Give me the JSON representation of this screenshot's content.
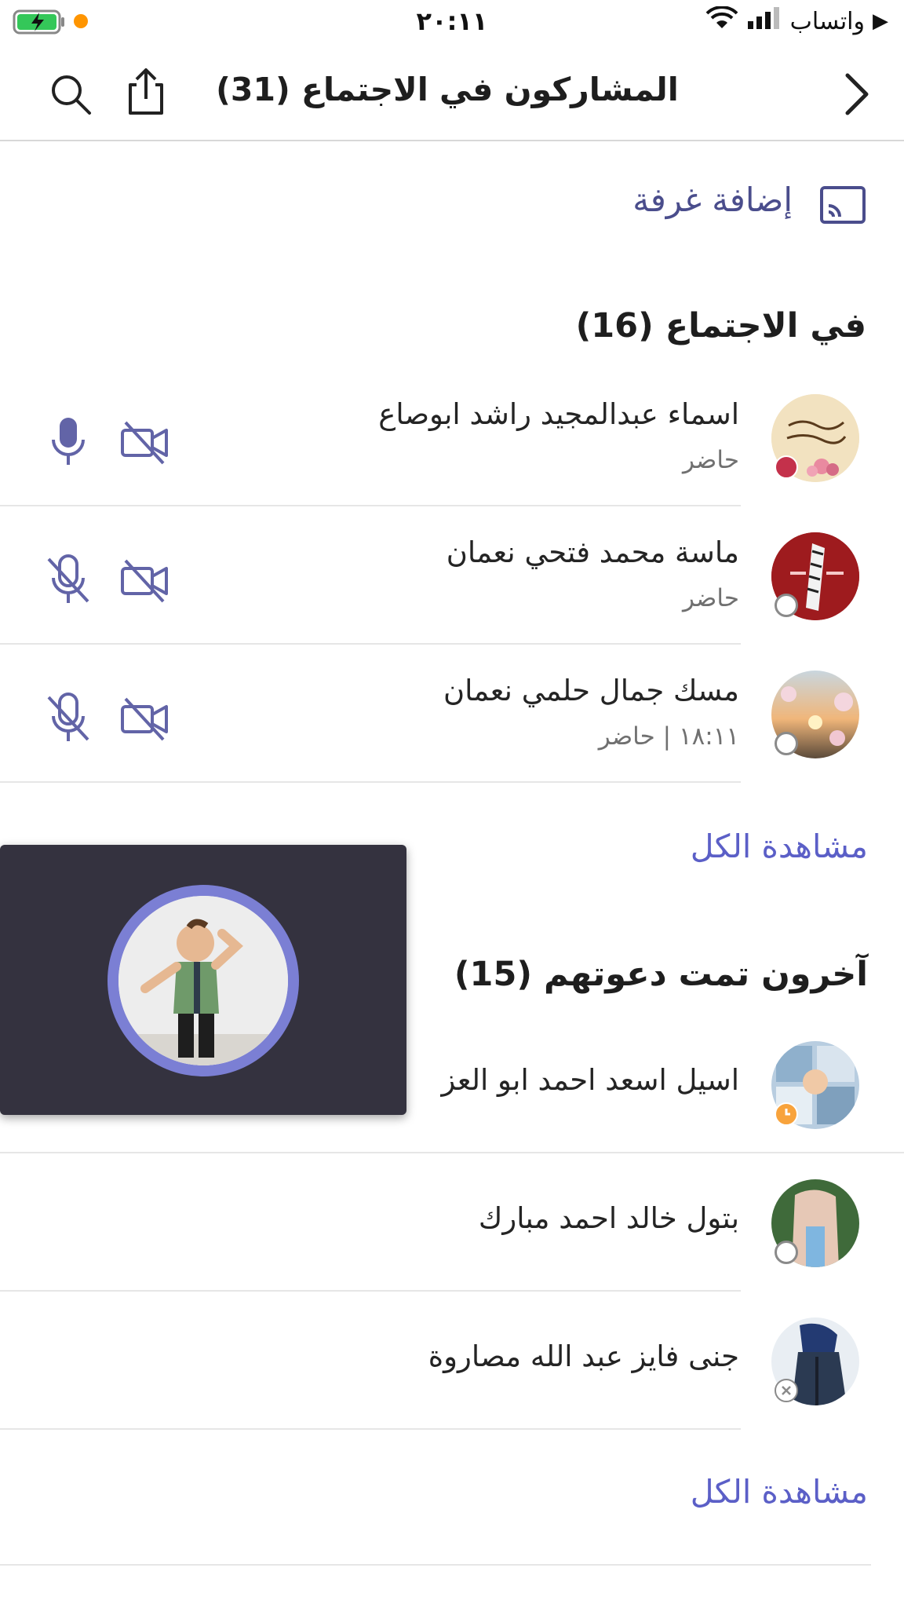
{
  "status_bar": {
    "time": "٢٠:١١",
    "carrier": "واتساب"
  },
  "header": {
    "title": "المشاركون في الاجتماع (31)"
  },
  "add_room": {
    "label": "إضافة غرفة"
  },
  "in_meeting": {
    "title": "في الاجتماع (16)",
    "participants": [
      {
        "name": "اسماء عبدالمجيد راشد ابوصاع",
        "status": "حاضر",
        "mic": "on",
        "camera": "off"
      },
      {
        "name": "ماسة محمد فتحي نعمان",
        "status": "حاضر",
        "mic": "off",
        "camera": "off"
      },
      {
        "name": "مسك جمال حلمي نعمان",
        "status": "١٨:١١ | حاضر",
        "mic": "off",
        "camera": "off"
      }
    ],
    "see_all": "مشاهدة الكل"
  },
  "invited": {
    "title": "آخرون تمت دعوتهم (15)",
    "participants": [
      {
        "name": "اسيل اسعد احمد ابو العز"
      },
      {
        "name": "بتول خالد احمد مبارك"
      },
      {
        "name": "جنى فايز عبد الله مصاروة"
      }
    ],
    "see_all": "مشاهدة الكل"
  },
  "colors": {
    "accent": "#5b5fc7",
    "presence_busy": "#c4314b",
    "presence_away": "#f8a33c",
    "video_bg": "#34323f"
  }
}
